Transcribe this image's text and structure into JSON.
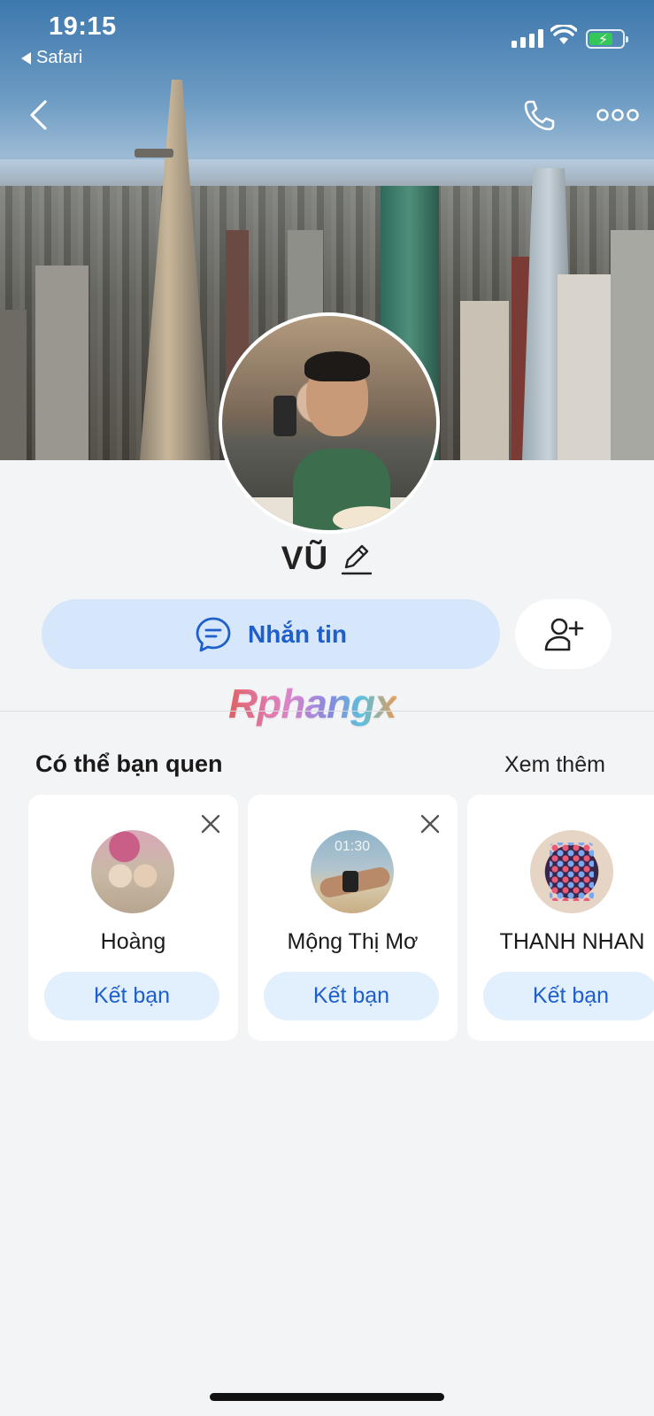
{
  "status_bar": {
    "time": "19:15",
    "back_app": "Safari"
  },
  "header": {
    "back_icon": "chevron-left-icon",
    "call_icon": "phone-icon",
    "more_icon": "more-horizontal-icon"
  },
  "profile": {
    "name": "VŨ"
  },
  "actions": {
    "message_label": "Nhắn tin",
    "add_friend_icon": "user-plus-icon"
  },
  "watermark": "Rphangx",
  "suggestions": {
    "title": "Có thể bạn quen",
    "see_more": "Xem thêm",
    "items": [
      {
        "name": "Hoàng",
        "button": "Kết bạn"
      },
      {
        "name": "Mộng Thị Mơ",
        "button": "Kết bạn",
        "avatar_text": "01:30"
      },
      {
        "name": "THANH NHAN",
        "button": "Kết bạn"
      }
    ]
  },
  "colors": {
    "accent": "#1e5fcc",
    "button_bg": "#d6e6fb",
    "page_bg": "#f3f4f6"
  }
}
